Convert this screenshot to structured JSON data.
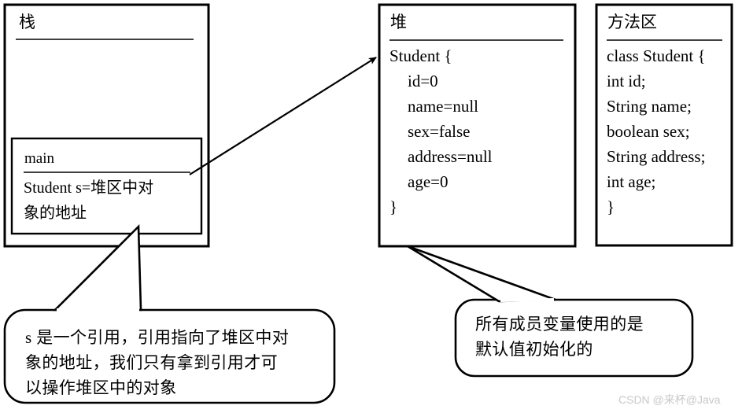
{
  "diagram": {
    "title_note": "Java memory layout: stack, heap and method area",
    "stroke_color": "#000000",
    "background_color": "#ffffff"
  },
  "stack_region": {
    "title": "栈",
    "frame": {
      "name": "main",
      "lines": [
        "Student s=堆区中对",
        "象的地址"
      ]
    }
  },
  "heap_region": {
    "title": "堆",
    "lines": [
      {
        "text": "Student {",
        "indent": false
      },
      {
        "text": "id=0",
        "indent": true
      },
      {
        "text": "name=null",
        "indent": true
      },
      {
        "text": "sex=false",
        "indent": true
      },
      {
        "text": "address=null",
        "indent": true
      },
      {
        "text": "age=0",
        "indent": true
      },
      {
        "text": "}",
        "indent": false
      }
    ]
  },
  "method_area_region": {
    "title": "方法区",
    "lines": [
      "class Student {",
      "int id;",
      "String name;",
      "boolean sex;",
      "String address;",
      "int age;",
      "}"
    ]
  },
  "callouts": [
    {
      "id": "stack-reference-callout",
      "lines": [
        "s 是一个引用，引用指向了堆区中对",
        "象的地址，我们只有拿到引用才可",
        "以操作堆区中的对象"
      ]
    },
    {
      "id": "default-values-callout",
      "lines": [
        "所有成员变量使用的是",
        "默认值初始化的"
      ]
    }
  ],
  "arrow": {
    "name": "stack-to-heap-reference-arrow",
    "from": "main frame variable s",
    "to": "heap Student object"
  },
  "watermark": {
    "text": "CSDN @来杯@Java",
    "color": "#c9c9c9"
  }
}
